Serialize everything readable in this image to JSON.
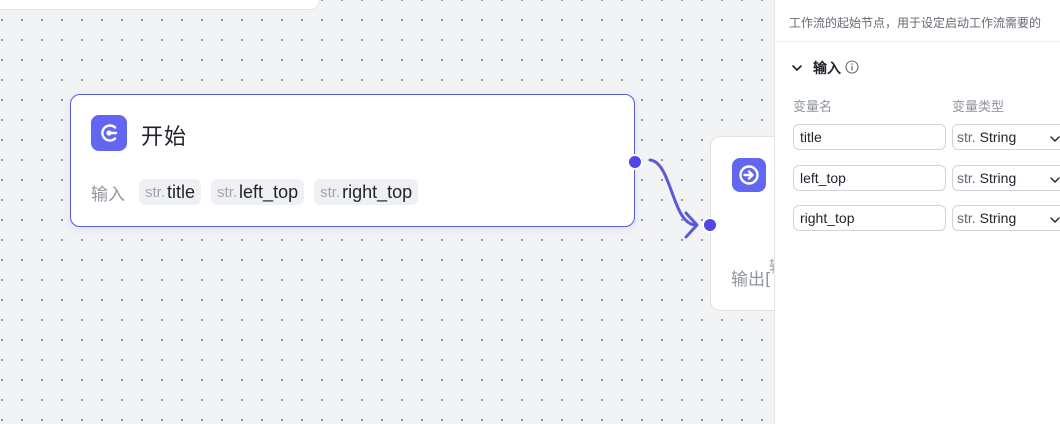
{
  "start_node": {
    "title": "开始",
    "inputs_label": "输入",
    "variables": [
      {
        "type": "str.",
        "name": "title"
      },
      {
        "type": "str.",
        "name": "left_top"
      },
      {
        "type": "str.",
        "name": "right_top"
      }
    ]
  },
  "end_node": {
    "faded_label": "输",
    "output_label": "输出["
  },
  "panel": {
    "description": "工作流的起始节点，用于设定启动工作流需要的",
    "section_title": "输入",
    "col_name": "变量名",
    "col_type": "变量类型",
    "rows": [
      {
        "name": "title",
        "type_prefix": "str.",
        "type": "String"
      },
      {
        "name": "left_top",
        "type_prefix": "str.",
        "type": "String"
      },
      {
        "name": "right_top",
        "type_prefix": "str.",
        "type": "String"
      }
    ]
  },
  "colors": {
    "accent": "#6366f1",
    "node_border": "#5b5bd6",
    "edge": "#5b5bd6"
  }
}
